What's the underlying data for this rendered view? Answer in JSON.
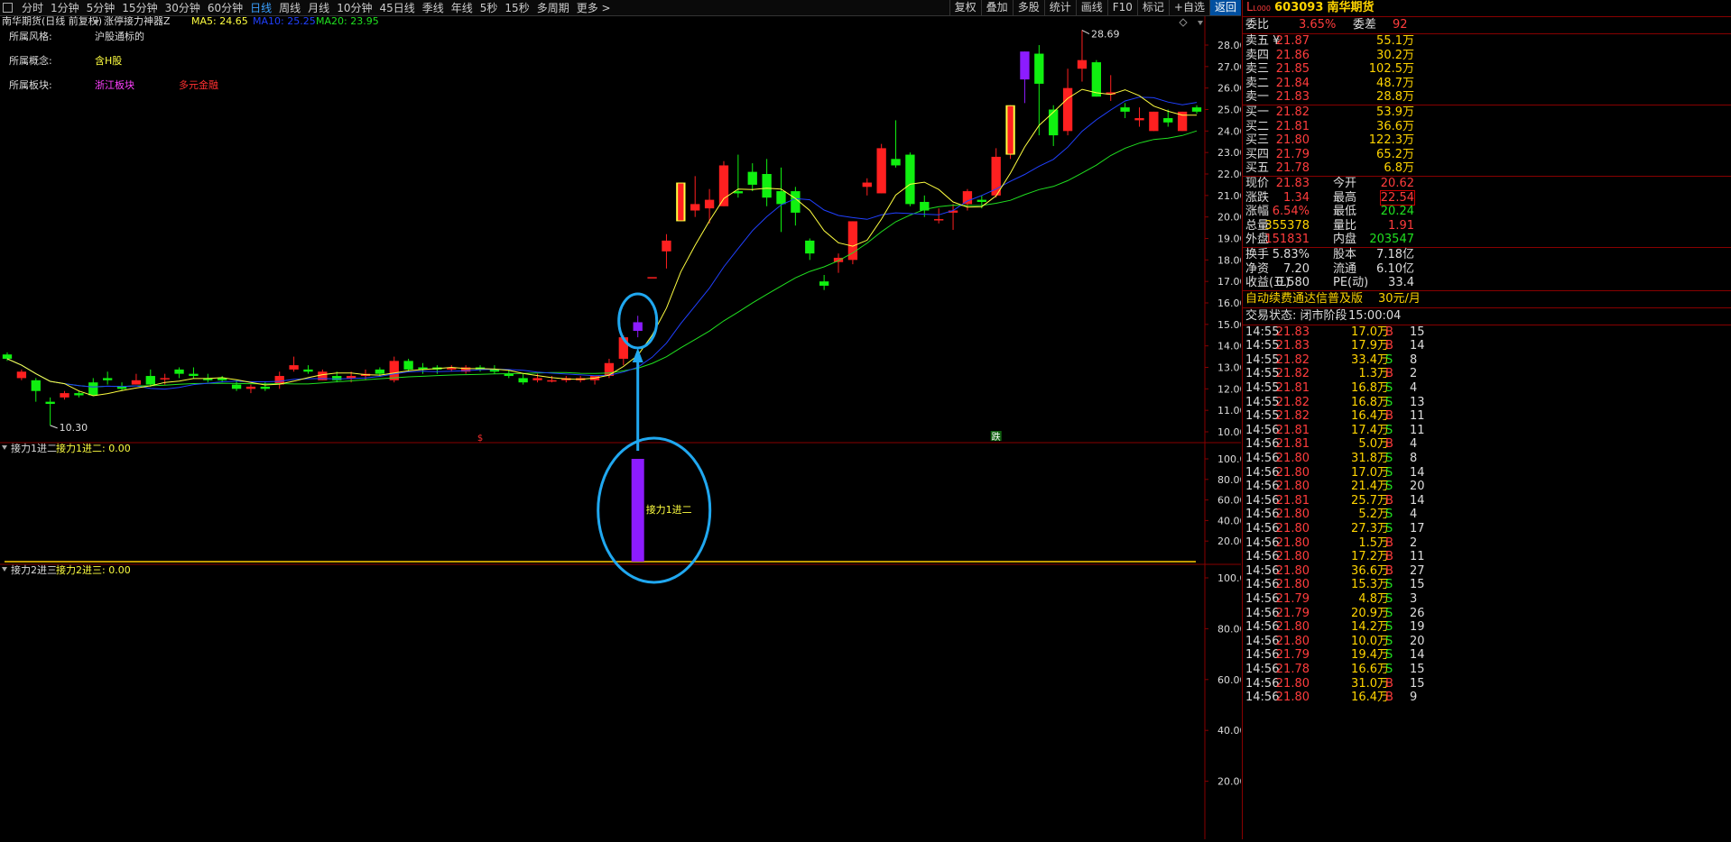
{
  "toolbar": {
    "menu_icon": "square-icon",
    "periods": [
      "分时",
      "1分钟",
      "5分钟",
      "15分钟",
      "30分钟",
      "60分钟",
      "日线",
      "周线",
      "月线",
      "10分钟",
      "45日线",
      "季线",
      "年线",
      "5秒",
      "15秒",
      "多周期",
      "更多 >"
    ],
    "active_period": "日线",
    "right_buttons": [
      "复权",
      "叠加",
      "多股",
      "统计",
      "画线",
      "F10",
      "标记",
      "+自选",
      "返回"
    ]
  },
  "chart": {
    "title": "南华期货(日线 前复权)",
    "indicator_name": "涨停接力神器Z",
    "ma5": "MA5: 24.65",
    "ma10": "MA10: 25.25",
    "ma20": "MA20: 23.95",
    "colors": {
      "up": "#ff2020",
      "down": "#10f010",
      "purple": "#8c1cff",
      "ma5": "#ffff40",
      "ma10": "#2040ff",
      "ma20": "#20e020"
    },
    "info": [
      {
        "label": "所属风格:",
        "values": [
          {
            "text": "沪股通标的",
            "color": "#dddddd"
          }
        ]
      },
      {
        "label": "所属概念:",
        "values": [
          {
            "text": "含H股",
            "color": "#ffff40"
          }
        ]
      },
      {
        "label": "所属板块:",
        "values": [
          {
            "text": "浙江板块",
            "color": "#ff40ff"
          },
          {
            "text": "多元金融",
            "color": "#ff3030"
          }
        ]
      }
    ],
    "price_ticks": [
      "28.00",
      "27.00",
      "26.00",
      "25.00",
      "24.00",
      "23.00",
      "22.00",
      "21.00",
      "20.00",
      "19.00",
      "18.00",
      "17.00",
      "16.00",
      "15.00",
      "14.00",
      "13.00",
      "12.00",
      "11.00",
      "10.00"
    ],
    "high_label": "28.69",
    "low_label": "10.30",
    "marker_s": "$",
    "marker_die": "跌",
    "sub1": {
      "label": "接力1进二",
      "value": "接力1进二: 0.00",
      "ticks": [
        "100.00",
        "80.00",
        "60.00",
        "40.00",
        "20.00"
      ],
      "annotation": "接力1进二",
      "bar_value": 100
    },
    "sub2": {
      "label": "接力2进三",
      "value": "接力2进三: 0.00",
      "ticks": [
        "100.00",
        "80.00",
        "60.00",
        "40.00",
        "20.00"
      ]
    }
  },
  "chart_data": {
    "type": "candlestick",
    "candles": [
      [
        13.6,
        13.7,
        13.3,
        13.4
      ],
      [
        12.5,
        12.9,
        12.4,
        12.8
      ],
      [
        12.4,
        12.5,
        11.4,
        11.9
      ],
      [
        11.4,
        11.6,
        10.3,
        11.3
      ],
      [
        11.6,
        11.9,
        11.5,
        11.8
      ],
      [
        11.8,
        11.9,
        11.6,
        11.7
      ],
      [
        12.3,
        12.5,
        11.7,
        11.7
      ],
      [
        12.5,
        12.8,
        12.2,
        12.4
      ],
      [
        12.1,
        12.3,
        11.9,
        12.0
      ],
      [
        12.2,
        12.7,
        12.2,
        12.4
      ],
      [
        12.6,
        12.9,
        12.1,
        12.2
      ],
      [
        12.5,
        12.7,
        12.2,
        12.5
      ],
      [
        12.9,
        13.0,
        12.5,
        12.7
      ],
      [
        12.7,
        13.0,
        12.5,
        12.6
      ],
      [
        12.5,
        12.7,
        12.3,
        12.4
      ],
      [
        12.5,
        12.6,
        12.3,
        12.4
      ],
      [
        12.2,
        12.4,
        11.9,
        12.0
      ],
      [
        12.0,
        12.2,
        11.8,
        12.1
      ],
      [
        12.1,
        12.3,
        11.9,
        12.0
      ],
      [
        12.2,
        12.8,
        12.0,
        12.6
      ],
      [
        12.9,
        13.5,
        12.8,
        13.1
      ],
      [
        12.9,
        13.1,
        12.7,
        12.8
      ],
      [
        12.4,
        12.9,
        12.4,
        12.8
      ],
      [
        12.6,
        12.8,
        12.3,
        12.4
      ],
      [
        12.5,
        12.8,
        12.3,
        12.6
      ],
      [
        12.6,
        12.9,
        12.4,
        12.7
      ],
      [
        12.9,
        13.0,
        12.6,
        12.7
      ],
      [
        12.4,
        13.5,
        12.3,
        13.3
      ],
      [
        13.3,
        13.4,
        12.8,
        12.9
      ],
      [
        13.0,
        13.2,
        12.7,
        12.9
      ],
      [
        13.0,
        13.1,
        12.7,
        12.9
      ],
      [
        12.9,
        13.1,
        12.8,
        13.0
      ],
      [
        12.8,
        13.1,
        12.7,
        13.0
      ],
      [
        13.0,
        13.1,
        12.8,
        12.9
      ],
      [
        12.9,
        13.1,
        12.7,
        12.8
      ],
      [
        12.7,
        12.9,
        12.5,
        12.6
      ],
      [
        12.5,
        12.7,
        12.2,
        12.3
      ],
      [
        12.4,
        12.7,
        12.3,
        12.5
      ],
      [
        12.4,
        12.6,
        12.3,
        12.4
      ],
      [
        12.4,
        12.6,
        12.3,
        12.5
      ],
      [
        12.4,
        12.6,
        12.3,
        12.5
      ],
      [
        12.4,
        12.6,
        12.2,
        12.6
      ],
      [
        12.6,
        13.4,
        12.5,
        13.2
      ],
      [
        13.4,
        14.5,
        13.1,
        14.4
      ],
      [
        14.7,
        15.4,
        14.4,
        15.1
      ],
      [
        17.2,
        17.2,
        17.2,
        17.2
      ],
      [
        18.4,
        19.2,
        17.6,
        18.9
      ],
      [
        19.8,
        21.6,
        19.8,
        21.6
      ],
      [
        20.3,
        21.9,
        20.0,
        20.6
      ],
      [
        20.4,
        21.3,
        19.7,
        20.8
      ],
      [
        20.5,
        22.6,
        20.5,
        22.4
      ],
      [
        21.2,
        22.9,
        20.9,
        21.1
      ],
      [
        22.1,
        22.5,
        21.2,
        21.5
      ],
      [
        22.0,
        22.7,
        20.5,
        20.9
      ],
      [
        21.2,
        22.3,
        19.3,
        20.6
      ],
      [
        21.2,
        21.4,
        19.6,
        20.2
      ],
      [
        18.9,
        19.0,
        18.0,
        18.3
      ],
      [
        17.0,
        17.3,
        16.6,
        16.8
      ],
      [
        17.9,
        18.3,
        17.4,
        18.1
      ],
      [
        18.0,
        19.8,
        17.8,
        19.8
      ],
      [
        21.4,
        21.8,
        21.0,
        21.6
      ],
      [
        21.1,
        23.4,
        21.1,
        23.2
      ],
      [
        22.7,
        24.5,
        22.3,
        22.4
      ],
      [
        22.9,
        23.0,
        20.5,
        20.6
      ],
      [
        20.7,
        21.0,
        20.0,
        20.3
      ],
      [
        19.9,
        20.4,
        19.7,
        19.9
      ],
      [
        20.2,
        20.6,
        19.4,
        20.3
      ],
      [
        20.6,
        21.3,
        20.3,
        21.2
      ],
      [
        20.8,
        21.0,
        20.4,
        20.7
      ],
      [
        21.0,
        23.2,
        20.9,
        22.8
      ],
      [
        22.9,
        25.2,
        22.7,
        25.2
      ],
      [
        27.7,
        27.7,
        25.3,
        26.4
      ],
      [
        27.6,
        28.0,
        23.8,
        26.2
      ],
      [
        25.0,
        25.2,
        23.3,
        23.8
      ],
      [
        24.0,
        26.9,
        23.8,
        26.0
      ],
      [
        26.9,
        28.7,
        26.3,
        27.3
      ],
      [
        27.2,
        27.3,
        25.6,
        25.6
      ],
      [
        25.7,
        26.6,
        25.4,
        25.8
      ],
      [
        25.1,
        25.3,
        24.6,
        24.9
      ],
      [
        24.5,
        25.1,
        24.2,
        24.6
      ],
      [
        24.0,
        24.9,
        24.0,
        24.9
      ],
      [
        24.6,
        25.0,
        24.2,
        24.4
      ],
      [
        24.0,
        24.9,
        24.0,
        24.9
      ],
      [
        25.1,
        25.2,
        24.8,
        24.9
      ]
    ],
    "purple_indices": [
      44,
      71
    ],
    "gold_indices": [
      47,
      70
    ],
    "y_range": [
      10,
      28.69
    ]
  },
  "panel": {
    "code": "603093",
    "name": "南华期货",
    "prefix": "L",
    "weibi_label": "委比",
    "weibi": "3.65%",
    "weicha_label": "委差",
    "weicha": "92",
    "asks": [
      {
        "label": "卖五 ¥",
        "price": "21.87",
        "vol": "55.1万"
      },
      {
        "label": "卖四",
        "price": "21.86",
        "vol": "30.2万"
      },
      {
        "label": "卖三",
        "price": "21.85",
        "vol": "102.5万"
      },
      {
        "label": "卖二",
        "price": "21.84",
        "vol": "48.7万"
      },
      {
        "label": "卖一",
        "price": "21.83",
        "vol": "28.8万"
      }
    ],
    "bids": [
      {
        "label": "买一",
        "price": "21.82",
        "vol": "53.9万"
      },
      {
        "label": "买二",
        "price": "21.81",
        "vol": "36.6万"
      },
      {
        "label": "买三",
        "price": "21.80",
        "vol": "122.3万"
      },
      {
        "label": "买四",
        "price": "21.79",
        "vol": "65.2万"
      },
      {
        "label": "买五",
        "price": "21.78",
        "vol": "6.8万"
      }
    ],
    "quotes": [
      {
        "l1": "现价",
        "v1": "21.83",
        "c1": "red",
        "l2": "今开",
        "v2": "20.62",
        "c2": "red"
      },
      {
        "l1": "涨跌",
        "v1": "1.34",
        "c1": "red",
        "l2": "最高",
        "v2": "22.54",
        "c2": "red",
        "box2": true
      },
      {
        "l1": "涨幅",
        "v1": "6.54%",
        "c1": "red",
        "l2": "最低",
        "v2": "20.24",
        "c2": "grn"
      },
      {
        "l1": "总量",
        "v1": "355378",
        "c1": "yel",
        "l2": "量比",
        "v2": "1.91",
        "c2": "red"
      },
      {
        "l1": "外盘",
        "v1": "151831",
        "c1": "red",
        "l2": "内盘",
        "v2": "203547",
        "c2": "grn"
      }
    ],
    "stats": [
      {
        "l1": "换手",
        "v1": "5.83%",
        "l2": "股本",
        "v2": "7.18亿"
      },
      {
        "l1": "净资",
        "v1": "7.20",
        "l2": "流通",
        "v2": "6.10亿"
      },
      {
        "l1": "收益(三)",
        "v1": "0.580",
        "l2": "PE(动)",
        "v2": "33.4"
      }
    ],
    "promo": "自动续费通达信普及版",
    "promo_price": "30元/月",
    "status_label": "交易状态: 闭市阶段",
    "status_time": "15:00:04",
    "ticks": [
      [
        "14:55",
        "21.83",
        "17.0万",
        "B",
        "15"
      ],
      [
        "14:55",
        "21.83",
        "17.9万",
        "B",
        "14"
      ],
      [
        "14:55",
        "21.82",
        "33.4万",
        "S",
        "8"
      ],
      [
        "14:55",
        "21.82",
        "1.3万",
        "B",
        "2"
      ],
      [
        "14:55",
        "21.81",
        "16.8万",
        "S",
        "4"
      ],
      [
        "14:55",
        "21.82",
        "16.8万",
        "S",
        "13"
      ],
      [
        "14:55",
        "21.82",
        "16.4万",
        "B",
        "11"
      ],
      [
        "14:56",
        "21.81",
        "17.4万",
        "S",
        "11"
      ],
      [
        "14:56",
        "21.81",
        "5.0万",
        "B",
        "4"
      ],
      [
        "14:56",
        "21.80",
        "31.8万",
        "S",
        "8"
      ],
      [
        "14:56",
        "21.80",
        "17.0万",
        "S",
        "14"
      ],
      [
        "14:56",
        "21.80",
        "21.4万",
        "S",
        "20"
      ],
      [
        "14:56",
        "21.81",
        "25.7万",
        "B",
        "14"
      ],
      [
        "14:56",
        "21.80",
        "5.2万",
        "S",
        "4"
      ],
      [
        "14:56",
        "21.80",
        "27.3万",
        "S",
        "17"
      ],
      [
        "14:56",
        "21.80",
        "1.5万",
        "B",
        "2"
      ],
      [
        "14:56",
        "21.80",
        "17.2万",
        "B",
        "11"
      ],
      [
        "14:56",
        "21.80",
        "36.6万",
        "B",
        "27"
      ],
      [
        "14:56",
        "21.80",
        "15.3万",
        "S",
        "15"
      ],
      [
        "14:56",
        "21.79",
        "4.8万",
        "S",
        "3"
      ],
      [
        "14:56",
        "21.79",
        "20.9万",
        "S",
        "26"
      ],
      [
        "14:56",
        "21.80",
        "14.2万",
        "S",
        "19"
      ],
      [
        "14:56",
        "21.80",
        "10.0万",
        "S",
        "20"
      ],
      [
        "14:56",
        "21.79",
        "19.4万",
        "S",
        "14"
      ],
      [
        "14:56",
        "21.78",
        "16.6万",
        "S",
        "15"
      ],
      [
        "14:56",
        "21.80",
        "31.0万",
        "B",
        "15"
      ],
      [
        "14:56",
        "21.80",
        "16.4万",
        "B",
        "9"
      ]
    ]
  }
}
